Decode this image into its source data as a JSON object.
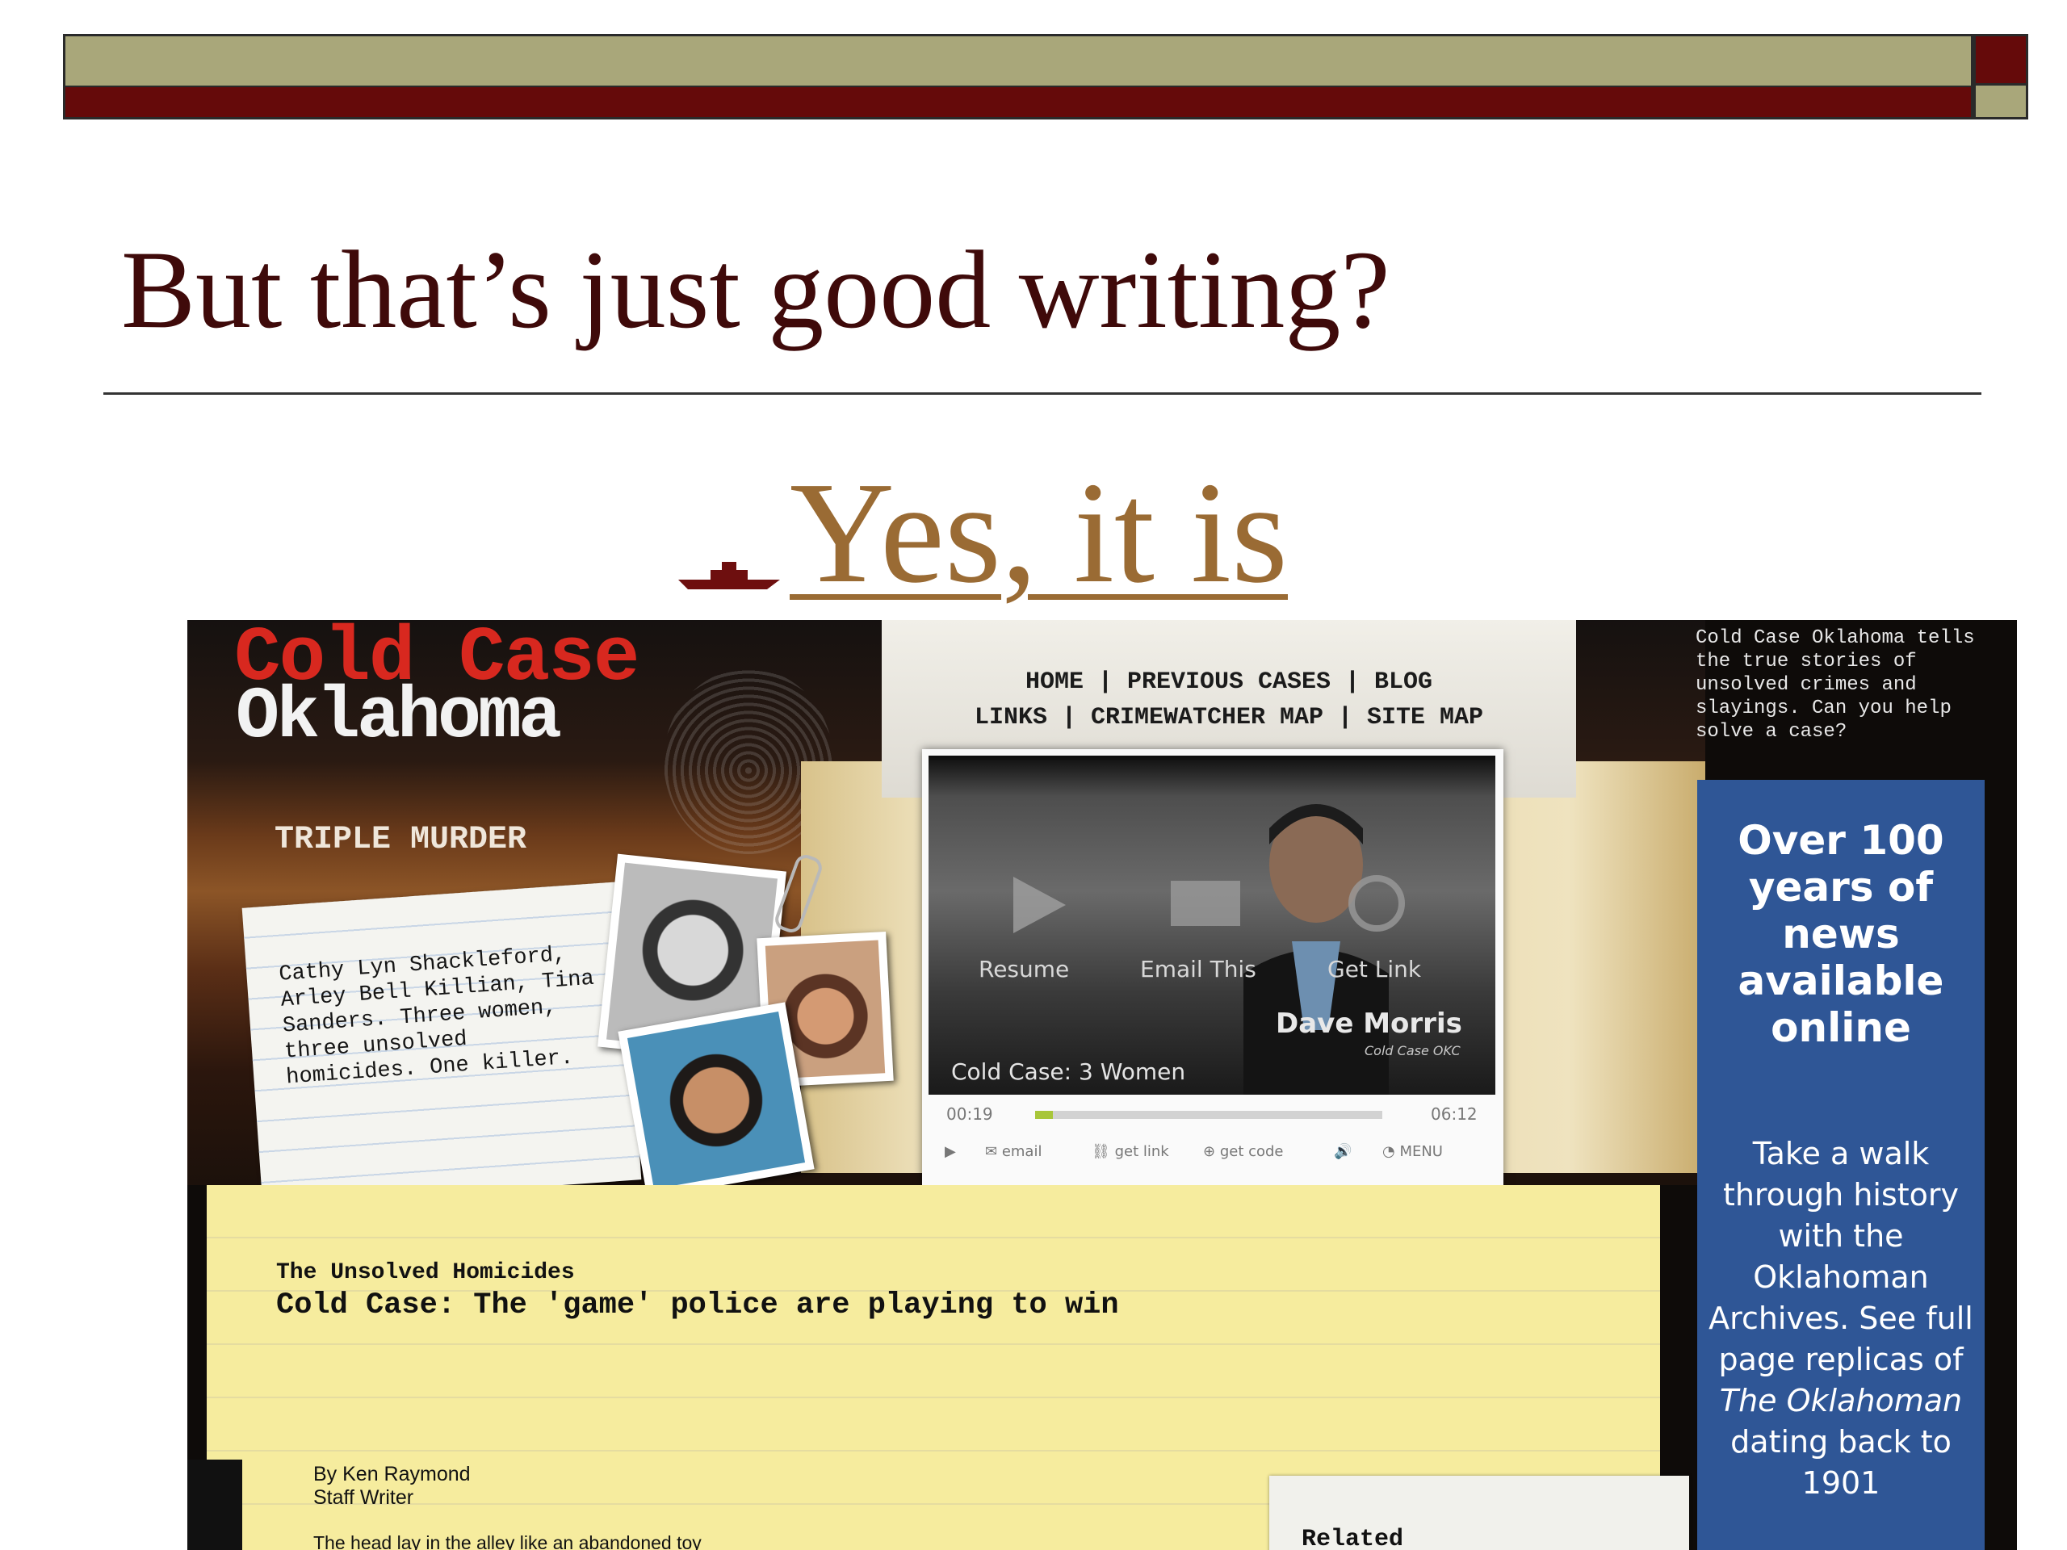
{
  "slide": {
    "title": "But that’s just good writing?",
    "subtitle": "Yes, it is",
    "colors": {
      "maroon": "#650a0a",
      "olive": "#a9a77a",
      "link": "#9a6b34",
      "title": "#3f0a0a"
    }
  },
  "site": {
    "logo_line1": "Cold Case",
    "logo_line2": "Oklahoma",
    "nav_row1": "HOME | PREVIOUS CASES | BLOG",
    "nav_row2": "LINKS | CRIMEWATCHER MAP | SITE MAP",
    "about": "Cold Case Oklahoma tells the true stories of unsolved crimes and slayings. Can you help solve a case?",
    "feature": {
      "label": "TRIPLE MURDER",
      "note": "Cathy Lyn Shackleford, Arley Bell Killian, Tina Sanders. Three women, three unsolved homicides. One killer."
    },
    "video": {
      "resume": "Resume",
      "email_this": "Email This",
      "get_link": "Get Link",
      "presenter_name": "Dave Morris",
      "presenter_sub": "Cold Case OKC",
      "title": "Cold Case: 3 Women",
      "time_current": "00:19",
      "time_total": "06:12",
      "progress": 0.05,
      "controls": {
        "email": "email",
        "get_link": "get link",
        "get_code": "get code",
        "menu": "MENU"
      }
    },
    "ad": {
      "headline": "Over 100 years of news available online",
      "body_before": "Take a walk through history with the Oklahoman Archives. See full page replicas of ",
      "body_italic": "The Oklahoman",
      "body_after": " dating back to 1901"
    },
    "article": {
      "kicker": "The Unsolved Homicides",
      "headline": "Cold Case: The 'game' police are playing to win",
      "byline_name": "By Ken Raymond",
      "byline_role": "Staff Writer",
      "lede": "The head lay in the alley like an abandoned toy"
    },
    "related": "Related"
  }
}
